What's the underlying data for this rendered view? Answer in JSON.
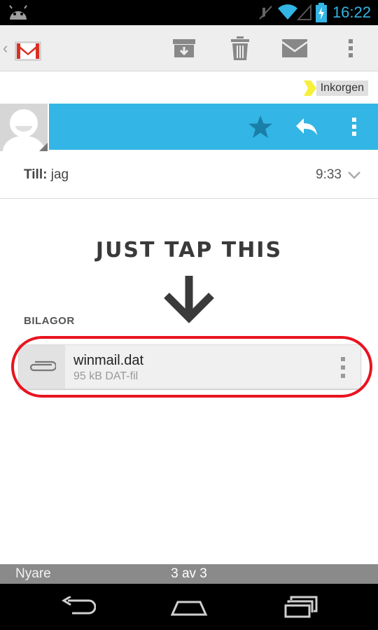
{
  "status_bar": {
    "time": "16:22"
  },
  "label": {
    "name": "Inkorgen"
  },
  "recipient": {
    "to_label": "Till:",
    "to_value": "jag",
    "time": "9:33"
  },
  "annotation": {
    "text": "JUST TAP THIS"
  },
  "attachments": {
    "header": "BILAGOR",
    "file_name": "winmail.dat",
    "file_meta": "95 kB DAT-fil"
  },
  "pager": {
    "newer_label": "Nyare",
    "position": "3 av 3"
  },
  "colors": {
    "accent": "#33b5e5",
    "highlight_ring": "#e8141f",
    "label_arrow": "#f7ef39"
  },
  "icons": [
    "android-icon",
    "mute-icon",
    "wifi-icon",
    "signal-icon",
    "battery-charging-icon",
    "gmail-logo-icon",
    "archive-icon",
    "trash-icon",
    "mark-unread-icon",
    "overflow-menu-icon",
    "contact-avatar-icon",
    "star-icon",
    "reply-icon",
    "chevron-down-icon",
    "paperclip-icon",
    "back-icon",
    "home-icon",
    "recent-apps-icon"
  ]
}
